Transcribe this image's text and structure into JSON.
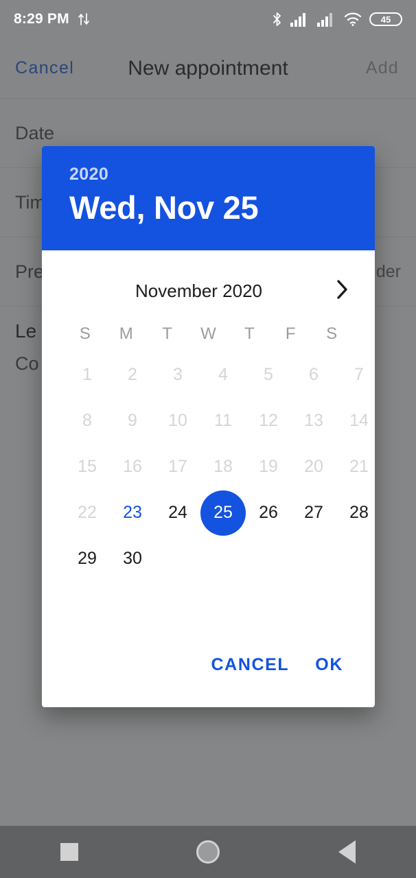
{
  "statusbar": {
    "time": "8:29 PM",
    "data_transfer_icon": "data-transfer-icon",
    "bluetooth_icon": "bluetooth-icon",
    "signal1_icon": "signal-bars-icon",
    "signal2_icon": "signal-bars-icon",
    "wifi_icon": "wifi-icon",
    "battery_level": "45"
  },
  "appbar": {
    "cancel_label": "Cancel",
    "title": "New appointment",
    "add_label": "Add"
  },
  "form": {
    "rows": [
      {
        "label": "Date",
        "value": ""
      },
      {
        "label": "Time",
        "value": ""
      },
      {
        "label": "Pre",
        "value": "der"
      }
    ],
    "block": {
      "label_strong": "Le",
      "label_sub": "Co"
    }
  },
  "dialog": {
    "header": {
      "year": "2020",
      "date": "Wed, Nov 25"
    },
    "month_label": "November 2020",
    "next_month_icon": "chevron-right-icon",
    "weekdays": [
      "S",
      "M",
      "T",
      "W",
      "T",
      "F",
      "S"
    ],
    "days": [
      {
        "n": "1",
        "state": "disabled"
      },
      {
        "n": "2",
        "state": "disabled"
      },
      {
        "n": "3",
        "state": "disabled"
      },
      {
        "n": "4",
        "state": "disabled"
      },
      {
        "n": "5",
        "state": "disabled"
      },
      {
        "n": "6",
        "state": "disabled"
      },
      {
        "n": "7",
        "state": "disabled"
      },
      {
        "n": "8",
        "state": "disabled"
      },
      {
        "n": "9",
        "state": "disabled"
      },
      {
        "n": "10",
        "state": "disabled"
      },
      {
        "n": "11",
        "state": "disabled"
      },
      {
        "n": "12",
        "state": "disabled"
      },
      {
        "n": "13",
        "state": "disabled"
      },
      {
        "n": "14",
        "state": "disabled"
      },
      {
        "n": "15",
        "state": "disabled"
      },
      {
        "n": "16",
        "state": "disabled"
      },
      {
        "n": "17",
        "state": "disabled"
      },
      {
        "n": "18",
        "state": "disabled"
      },
      {
        "n": "19",
        "state": "disabled"
      },
      {
        "n": "20",
        "state": "disabled"
      },
      {
        "n": "21",
        "state": "disabled"
      },
      {
        "n": "22",
        "state": "disabled"
      },
      {
        "n": "23",
        "state": "today"
      },
      {
        "n": "24",
        "state": "normal"
      },
      {
        "n": "25",
        "state": "selected"
      },
      {
        "n": "26",
        "state": "normal"
      },
      {
        "n": "27",
        "state": "normal"
      },
      {
        "n": "28",
        "state": "normal"
      },
      {
        "n": "29",
        "state": "normal"
      },
      {
        "n": "30",
        "state": "normal"
      }
    ],
    "cancel_label": "CANCEL",
    "ok_label": "OK"
  },
  "navbar": {
    "recents_icon": "square-recents-icon",
    "home_icon": "circle-home-icon",
    "back_icon": "triangle-back-icon"
  },
  "colors": {
    "accent": "#1452e0",
    "scrim": "#5f6163",
    "disabled_text": "#d4d5d6",
    "appbar_disabled": "#9a9a9a"
  }
}
